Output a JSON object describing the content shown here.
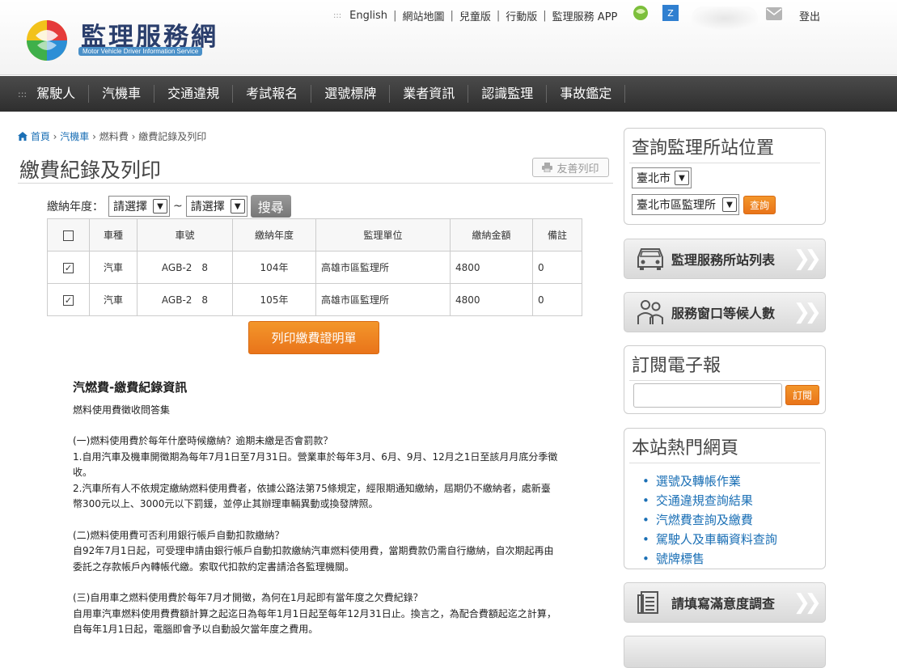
{
  "header": {
    "logo_title": "監理服務網",
    "logo_subtitle": "Motor Vehicle Driver Information Service",
    "top_links": [
      "English",
      "網站地圖",
      "兒童版",
      "行動版",
      "監理服務 APP"
    ],
    "logout": "登出"
  },
  "nav": {
    "items": [
      "駕駛人",
      "汽機車",
      "交通違規",
      "考試報名",
      "選號標牌",
      "業者資訊",
      "認識監理",
      "事故鑑定"
    ]
  },
  "breadcrumb": {
    "home": "首頁",
    "items": [
      "汽機車",
      "燃料費",
      "繳費記錄及列印"
    ]
  },
  "page": {
    "title": "繳費紀錄及列印",
    "print_label": "友善列印"
  },
  "filter": {
    "label": "繳納年度：",
    "from_value": "請選擇",
    "tilde": "~",
    "to_value": "請選擇",
    "search_label": "搜尋"
  },
  "table": {
    "headers": [
      "車種",
      "車號",
      "繳納年度",
      "監理單位",
      "繳納金額",
      "備註"
    ],
    "rows": [
      {
        "checked": true,
        "type": "汽車",
        "plate": "AGB-2　8",
        "year": "104年",
        "office": "高雄市區監理所",
        "amount": "4800",
        "note": "0"
      },
      {
        "checked": true,
        "type": "汽車",
        "plate": "AGB-2　8",
        "year": "105年",
        "office": "高雄市區監理所",
        "amount": "4800",
        "note": "0"
      }
    ]
  },
  "print_cert_label": "列印繳費證明單",
  "article": {
    "heading": "汽燃費-繳費紀錄資訊",
    "subheading": "燃料使用費徵收問答集",
    "q1": "(一)燃料使用費於每年什麼時候繳納？逾期未繳是否會罰款？",
    "q1_a1": "1.自用汽車及機車開徵期為每年7月1日至7月31日。營業車於每年3月、6月、9月、12月之1日至該月月底分季徵收。",
    "q1_a2": "2.汽車所有人不依規定繳納燃料使用費者，依據公路法第75條規定，經限期通知繳納，屆期仍不繳納者，處新臺幣300元以上、3000元以下罰鍰，並停止其辦理車輛異動或換發牌照。",
    "q2": "(二)燃料使用費可否利用銀行帳戶自動扣款繳納？",
    "q2_a": "自92年7月1日起，可受理申請由銀行帳戶自動扣款繳納汽車燃料使用費，當期費款仍需自行繳納，自次期起再由委託之存款帳戶內轉帳代繳。索取代扣款約定書請洽各監理機關。",
    "q3": "(三)自用車之燃料使用費於每年7月才開徵，為何在1月起即有當年度之欠費紀錄？",
    "q3_a": "自用車汽車燃料使用費費額計算之起迄日為每年1月1日起至每年12月31日止。換言之，為配合費額起迄之計算，自每年1月1日起，電腦即會予以自動設欠當年度之費用。"
  },
  "sidebar": {
    "station_title": "查詢監理所站位置",
    "city_value": "臺北市",
    "office_value": "臺北市區監理所",
    "query_label": "查詢",
    "station_list_label": "監理服務所站列表",
    "waiting_label": "服務窗口等候人數",
    "newsletter_title": "訂閱電子報",
    "newsletter_placeholder": "",
    "subscribe_label": "訂閱",
    "hot_title": "本站熱門網頁",
    "hot_links": [
      "選號及轉帳作業",
      "交通違規查詢結果",
      "汽燃費查詢及繳費",
      "駕駛人及車輛資料查詢",
      "號牌標售"
    ],
    "survey_label": "請填寫滿意度調查"
  }
}
